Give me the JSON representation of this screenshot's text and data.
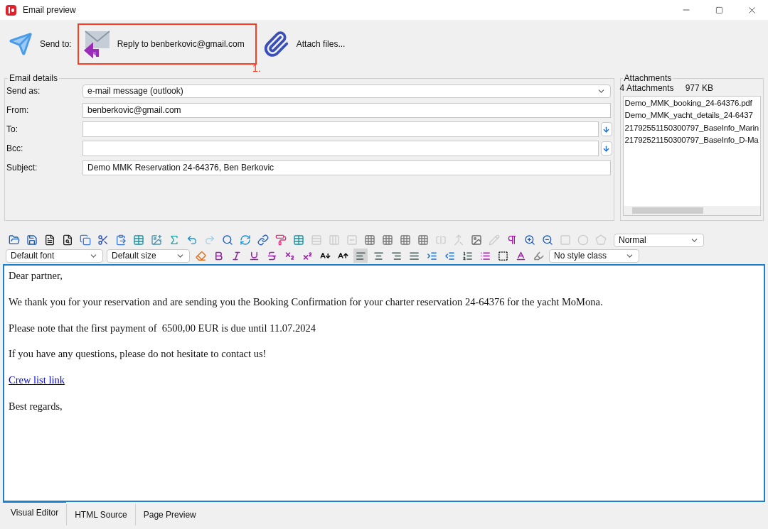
{
  "window": {
    "title": "Email preview"
  },
  "send_bar": {
    "send_label": "Send to:",
    "reply_button": "Reply to benberkovic@gmail.com",
    "callout": "1.",
    "attach_button": "Attach files..."
  },
  "email_details": {
    "title": "Email details",
    "fields": [
      {
        "label": "Send as:",
        "kind": "select",
        "value": "e-mail message (outlook)"
      },
      {
        "label": "From:",
        "kind": "text",
        "value": "benberkovic@gmail.com"
      },
      {
        "label": "To:",
        "kind": "address"
      },
      {
        "label": "Bcc:",
        "kind": "address"
      },
      {
        "label": "Subject:",
        "kind": "text",
        "value": "Demo MMK Reservation 24-64376, Ben Berkovic"
      }
    ]
  },
  "attachments": {
    "title": "Attachments",
    "count": "4 Attachments",
    "size": "977 KB",
    "files": [
      "Demo_MMK_booking_24-64376.pdf",
      "Demo_MMK_yacht_details_24-6437",
      "21792551150300797_BaseInfo_Marin",
      "21792521150300797_BaseInfo_D-Ma"
    ]
  },
  "toolbar_1": {
    "tools": [
      {
        "kind": "word-open",
        "disabled": false
      },
      {
        "kind": "word-save",
        "disabled": false
      },
      {
        "kind": "document",
        "disabled": false
      },
      {
        "kind": "preview",
        "disabled": false
      },
      {
        "kind": "copy",
        "disabled": false
      },
      {
        "kind": "cut",
        "disabled": false
      },
      {
        "kind": "paste",
        "disabled": false
      },
      {
        "kind": "table",
        "disabled": false
      },
      {
        "kind": "image",
        "disabled": false
      },
      {
        "kind": "sigma",
        "disabled": false
      },
      {
        "kind": "undo",
        "disabled": false
      },
      {
        "kind": "redo",
        "disabled": true
      },
      {
        "kind": "search",
        "disabled": false
      },
      {
        "kind": "replace",
        "disabled": false
      },
      {
        "kind": "link",
        "disabled": false
      },
      {
        "kind": "paint",
        "disabled": false
      },
      {
        "kind": "table",
        "disabled": false
      },
      {
        "kind": "row-add",
        "disabled": true
      },
      {
        "kind": "col-add",
        "disabled": true
      },
      {
        "kind": "row-remove",
        "disabled": true
      },
      {
        "kind": "grid",
        "disabled": false
      },
      {
        "kind": "grid",
        "disabled": false
      },
      {
        "kind": "grid",
        "disabled": false
      },
      {
        "kind": "grid",
        "disabled": false
      },
      {
        "kind": "split",
        "disabled": true
      },
      {
        "kind": "merge",
        "disabled": true
      },
      {
        "kind": "image-edit",
        "disabled": false
      },
      {
        "kind": "edit",
        "disabled": true
      },
      {
        "kind": "pilcrow",
        "disabled": false
      },
      {
        "kind": "zoom-in",
        "disabled": false
      },
      {
        "kind": "zoom-out",
        "disabled": false
      },
      {
        "kind": "rect",
        "disabled": true
      },
      {
        "kind": "circle",
        "disabled": true
      },
      {
        "kind": "pentagon",
        "disabled": true
      }
    ],
    "block_format": "Normal"
  },
  "toolbar_2": {
    "font": "Default font",
    "size": "Default size",
    "tools": [
      {
        "kind": "clear",
        "selected": false
      },
      {
        "kind": "bold",
        "selected": false
      },
      {
        "kind": "italic",
        "selected": false
      },
      {
        "kind": "underline",
        "selected": false
      },
      {
        "kind": "strike",
        "selected": false
      },
      {
        "kind": "subscript",
        "selected": false
      },
      {
        "kind": "superscript",
        "selected": false
      },
      {
        "kind": "smaller",
        "selected": false
      },
      {
        "kind": "bigger",
        "selected": false
      },
      {
        "kind": "align-left",
        "selected": true
      },
      {
        "kind": "align-center",
        "selected": false
      },
      {
        "kind": "align-right",
        "selected": false
      },
      {
        "kind": "justify",
        "selected": false
      },
      {
        "kind": "indent",
        "selected": false
      },
      {
        "kind": "outdent",
        "selected": false
      },
      {
        "kind": "ol",
        "selected": false
      },
      {
        "kind": "ul",
        "selected": false
      },
      {
        "kind": "border",
        "selected": false
      },
      {
        "kind": "font-color",
        "selected": false
      },
      {
        "kind": "highlight",
        "selected": false
      }
    ],
    "style_class": "No style class"
  },
  "editor": {
    "paragraphs": [
      {
        "kind": "text",
        "text": "Dear partner,"
      },
      {
        "kind": "text",
        "text": "We thank you for your reservation and are sending you the Booking Confirmation for your charter reservation 24-64376 for the yacht MoMona."
      },
      {
        "kind": "text",
        "text": "Please note that the first payment of  6500,00 EUR is due until 11.07.2024"
      },
      {
        "kind": "text",
        "text": "If you have any questions, please do not hesitate to contact us!"
      },
      {
        "kind": "link",
        "text": "Crew list link"
      },
      {
        "kind": "text",
        "text": "Best regards,"
      }
    ]
  },
  "tabs": [
    {
      "label": "Visual Editor",
      "selected": true
    },
    {
      "label": "HTML Source",
      "selected": false
    },
    {
      "label": "Page Preview",
      "selected": false
    }
  ]
}
